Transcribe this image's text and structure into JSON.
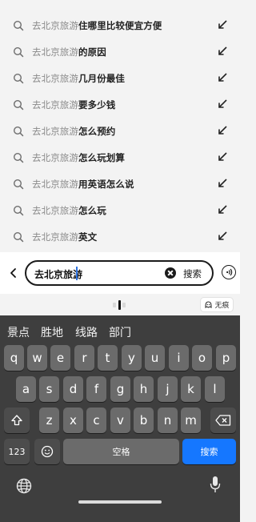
{
  "suggestions": [
    {
      "query": "去北京旅游",
      "rest": "住哪里比较便宜方便"
    },
    {
      "query": "去北京旅游",
      "rest": "的原因"
    },
    {
      "query": "去北京旅游",
      "rest": "几月份最佳"
    },
    {
      "query": "去北京旅游",
      "rest": "要多少钱"
    },
    {
      "query": "去北京旅游",
      "rest": "怎么预约"
    },
    {
      "query": "去北京旅游",
      "rest": "怎么玩划算"
    },
    {
      "query": "去北京旅游",
      "rest": "用英语怎么说"
    },
    {
      "query": "去北京旅游",
      "rest": "怎么玩"
    },
    {
      "query": "去北京旅游",
      "rest": "英文"
    }
  ],
  "search": {
    "value": "去北京旅游",
    "submit_label": "搜索"
  },
  "toolbar": {
    "incognito_label": "无痕"
  },
  "keyboard": {
    "candidates": [
      "景点",
      "胜地",
      "线路",
      "部门"
    ],
    "row1": [
      "q",
      "w",
      "e",
      "r",
      "t",
      "y",
      "u",
      "i",
      "o",
      "p"
    ],
    "row2": [
      "a",
      "s",
      "d",
      "f",
      "g",
      "h",
      "j",
      "k",
      "l"
    ],
    "row3": [
      "z",
      "x",
      "c",
      "v",
      "b",
      "n",
      "m"
    ],
    "numbers_label": "123",
    "space_label": "空格",
    "return_label": "搜索"
  },
  "colors": {
    "accent": "#1577ff",
    "keyboard_bg": "#3e3e3e",
    "key_bg": "#6b6b6b",
    "caret": "#2f73e0"
  }
}
